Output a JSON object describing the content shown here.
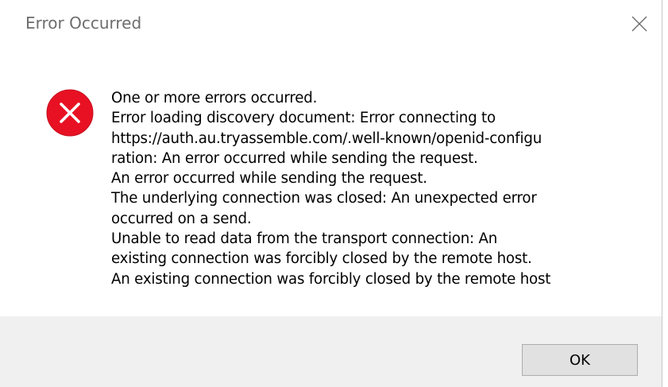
{
  "dialog": {
    "title": "Error Occurred",
    "close_icon": "close-icon",
    "error_icon": "error-icon",
    "colors": {
      "error_red": "#e81123",
      "footer_bg": "#f0f0f0",
      "button_bg": "#e1e1e1",
      "button_border": "#adadad",
      "title_text": "#6d6d6d"
    },
    "message_lines": [
      "One or more errors occurred.",
      "Error loading discovery document: Error connecting to",
      "https://auth.au.tryassemble.com/.well-known/openid-configu",
      "ration: An error occurred while sending the request.",
      "An error occurred while sending the request.",
      "The underlying connection was closed: An unexpected error",
      "occurred on a send.",
      "Unable to read data from the transport connection: An",
      "existing connection was forcibly closed by the remote host.",
      "An existing connection was forcibly closed by the remote host"
    ],
    "ok_label": "OK"
  }
}
